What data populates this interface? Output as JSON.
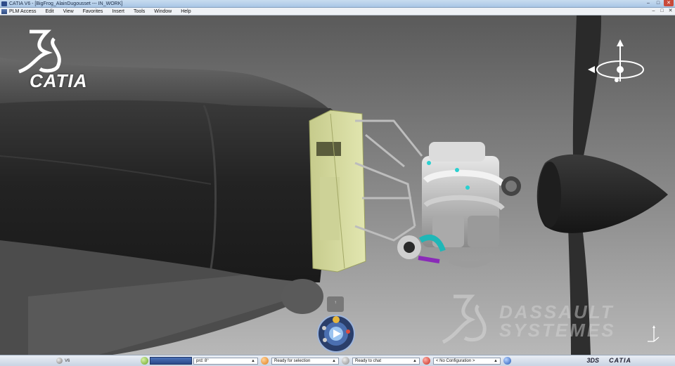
{
  "window": {
    "title": "CATIA V6 - [BigFrog_AlainDugousset --- IN_WORK]"
  },
  "menu": {
    "items": [
      "PLM Access",
      "Edit",
      "View",
      "Favorites",
      "Insert",
      "Tools",
      "Window",
      "Help"
    ]
  },
  "logo": {
    "brand": "CATIA",
    "mark": "3DS"
  },
  "watermark": {
    "line1": "DASSAULT",
    "line2": "SYSTEMES"
  },
  "statusbar": {
    "v6_label": "V6",
    "command_field": "prd: 8°",
    "selection_status": "Ready for selection",
    "chat_status": "Ready to chat",
    "configuration": "< No Configuration >",
    "brand": "CATIA",
    "brand_mark": "3DS"
  },
  "colors": {
    "titlebar": "#b8d1ec",
    "background_top": "#5e5e5e",
    "background_bottom": "#b4b4b4",
    "firewall": "#d6dca0",
    "fuselage": "#2c2c2c"
  },
  "icons": [
    "app-icon",
    "minimize-icon",
    "maximize-icon",
    "close-icon",
    "compass-icon",
    "robot-icon",
    "axis-triad-icon"
  ]
}
